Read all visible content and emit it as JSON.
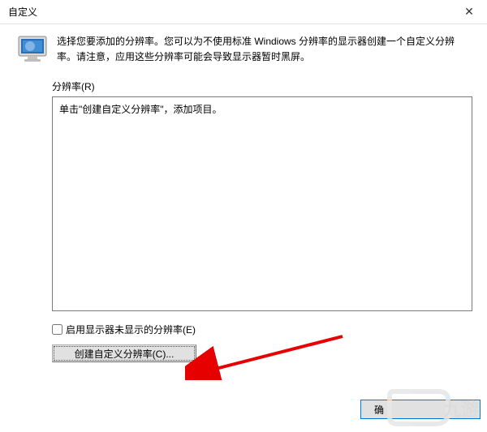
{
  "window": {
    "title": "自定义"
  },
  "intro": {
    "text": "选择您要添加的分辨率。您可以为不使用标准 Windiows 分辨率的显示器创建一个自定义分辨率。请注意，应用这些分辨率可能会导致显示器暂时黑屏。"
  },
  "resolution": {
    "label": "分辨率(R)",
    "placeholder_text": "单击\"创建自定义分辨率\"，添加项目。"
  },
  "checkbox": {
    "label": "启用显示器未显示的分辨率(E)"
  },
  "buttons": {
    "create": "创建自定义分辨率(C)...",
    "ok": "确"
  },
  "watermark": {
    "brand": "九游"
  }
}
